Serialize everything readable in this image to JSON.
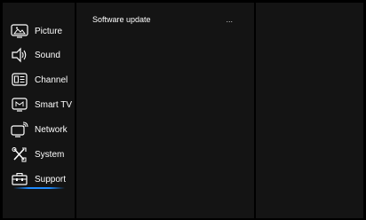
{
  "sidebar": {
    "items": [
      {
        "label": "Picture",
        "icon": "picture-icon"
      },
      {
        "label": "Sound",
        "icon": "speaker-icon"
      },
      {
        "label": "Channel",
        "icon": "channel-icon"
      },
      {
        "label": "Smart TV",
        "icon": "smart-tv-icon"
      },
      {
        "label": "Network",
        "icon": "network-icon"
      },
      {
        "label": "System",
        "icon": "tools-icon"
      },
      {
        "label": "Support",
        "icon": "toolbox-icon"
      }
    ],
    "selected": "Support",
    "accent_color": "#1e8bff"
  },
  "submenu": {
    "items": [
      {
        "label": "Software update",
        "value": "..."
      }
    ]
  }
}
